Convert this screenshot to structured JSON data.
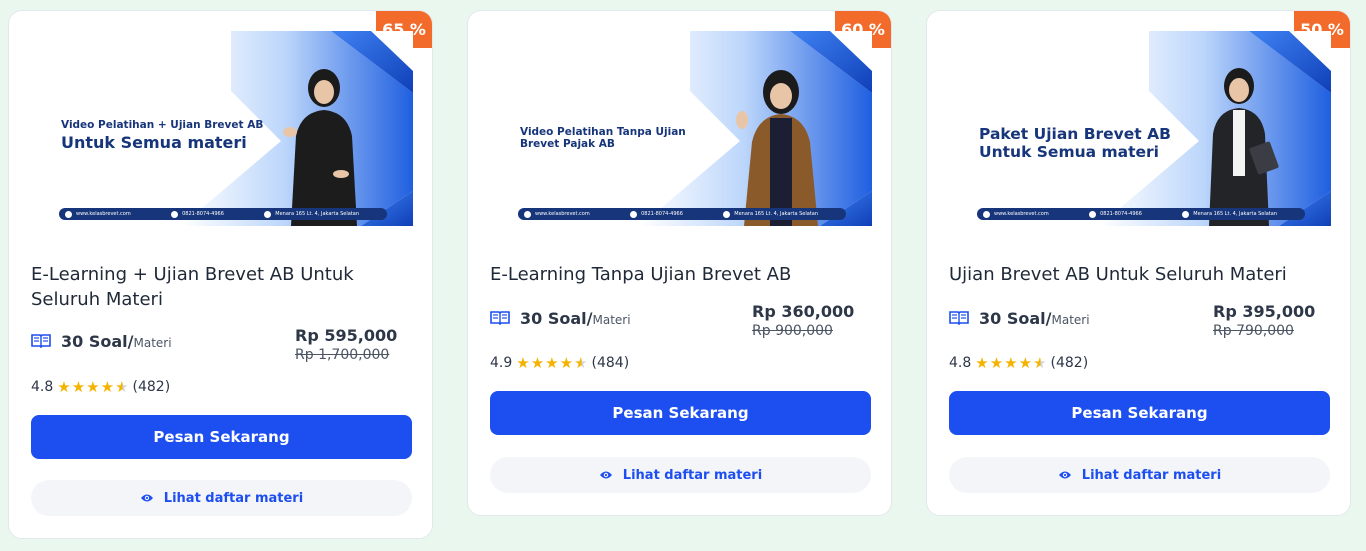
{
  "colors": {
    "page_bg": "#eaf7ee",
    "primary": "#1d4ef0",
    "badge": "#f26b2a",
    "star": "#f5b301",
    "banner_navy": "#17357a"
  },
  "cards": [
    {
      "discount": "65 %",
      "banner": {
        "line1": "Video Pelatihan + Ujian Brevet AB",
        "line2": "Untuk Semua materi",
        "website": "www.kelasbrevet.com",
        "phone": "0821-8074-4966",
        "address": "Menara 165 Lt. 4, Jakarta Selatan"
      },
      "title": "E-Learning + Ujian Brevet AB Untuk Seluruh Materi",
      "soal_count": "30 Soal/",
      "soal_unit": "Materi",
      "price_now": "Rp 595,000",
      "price_was": "Rp 1,700,000",
      "rating": "4.8",
      "stars": 4.5,
      "reviews": "(482)",
      "order_label": "Pesan Sekarang",
      "materi_label": "Lihat daftar materi",
      "icons": [
        "book-icon",
        "star-icon",
        "eye-icon"
      ]
    },
    {
      "discount": "60 %",
      "banner": {
        "line1": "Video Pelatihan Tanpa Ujian",
        "line2": "Brevet Pajak AB",
        "website": "www.kelasbrevet.com",
        "phone": "0821-8074-4966",
        "address": "Menara 165 Lt. 4, Jakarta Selatan"
      },
      "title": "E-Learning Tanpa Ujian Brevet AB",
      "soal_count": "30 Soal/",
      "soal_unit": "Materi",
      "price_now": "Rp 360,000",
      "price_was": "Rp 900,000",
      "rating": "4.9",
      "stars": 4.5,
      "reviews": "(484)",
      "order_label": "Pesan Sekarang",
      "materi_label": "Lihat daftar materi",
      "icons": [
        "book-icon",
        "star-icon",
        "eye-icon"
      ]
    },
    {
      "discount": "50 %",
      "banner": {
        "line1": "Paket Ujian Brevet AB",
        "line2": "Untuk Semua materi",
        "website": "www.kelasbrevet.com",
        "phone": "0821-8074-4966",
        "address": "Menara 165 Lt. 4, Jakarta Selatan"
      },
      "title": "Ujian Brevet AB Untuk Seluruh Materi",
      "soal_count": "30 Soal/",
      "soal_unit": "Materi",
      "price_now": "Rp 395,000",
      "price_was": "Rp 790,000",
      "rating": "4.8",
      "stars": 4.5,
      "reviews": "(482)",
      "order_label": "Pesan Sekarang",
      "materi_label": "Lihat daftar materi",
      "icons": [
        "book-icon",
        "star-icon",
        "eye-icon"
      ]
    }
  ]
}
